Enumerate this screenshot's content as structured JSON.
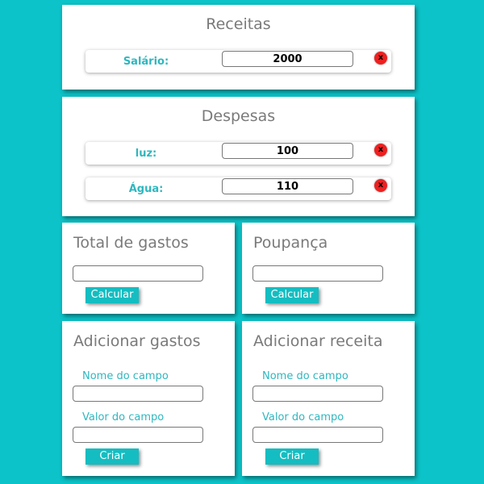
{
  "receitas": {
    "title": "Receitas",
    "items": [
      {
        "label": "Salário:",
        "value": "2000",
        "delete": "x"
      }
    ]
  },
  "despesas": {
    "title": "Despesas",
    "items": [
      {
        "label": "luz:",
        "value": "100",
        "delete": "x"
      },
      {
        "label": "Água:",
        "value": "110",
        "delete": "x"
      }
    ]
  },
  "total_gastos": {
    "title": "Total de gastos",
    "value": "",
    "button": "Calcular"
  },
  "poupanca": {
    "title": "Poupança",
    "value": "",
    "button": "Calcular"
  },
  "adicionar_gastos": {
    "title": "Adicionar gastos",
    "nome_label": "Nome do campo",
    "nome_value": "",
    "valor_label": "Valor do campo",
    "valor_value": "",
    "button": "Criar"
  },
  "adicionar_receita": {
    "title": "Adicionar receita",
    "nome_label": "Nome do campo",
    "nome_value": "",
    "valor_label": "Valor do campo",
    "valor_value": "",
    "button": "Criar"
  },
  "colors": {
    "background": "#0bc3c8",
    "accent": "#14bdc1",
    "label": "#2fb7bf",
    "title": "#7a7a7a",
    "delete": "#ee2020"
  }
}
